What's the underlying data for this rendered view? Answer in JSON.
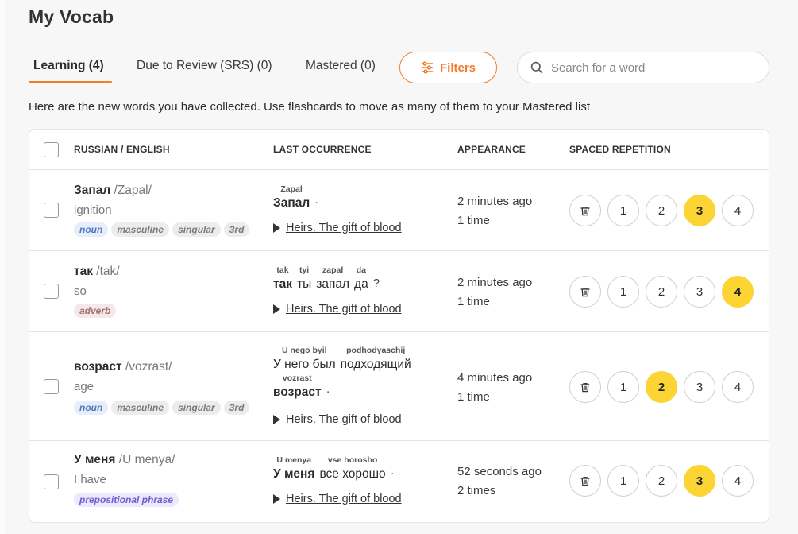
{
  "header": {
    "title": "My Vocab"
  },
  "tabs": [
    {
      "label": "Learning (4)",
      "active": true
    },
    {
      "label": "Due to Review (SRS) (0)",
      "active": false
    },
    {
      "label": "Mastered (0)",
      "active": false
    }
  ],
  "filters": {
    "label": "Filters",
    "icon": "sliders-icon"
  },
  "search": {
    "placeholder": "Search for a word",
    "value": ""
  },
  "intro": "Here are the new words you have collected. Use flashcards to move as many of them to your Mastered list",
  "table": {
    "headers": [
      "RUSSIAN / ENGLISH",
      "LAST OCCURRENCE",
      "APPEARANCE",
      "SPACED REPETITION"
    ],
    "rows": [
      {
        "word": "Запал",
        "translit": "/Zapal/",
        "meaning": "ignition",
        "tags": [
          "noun",
          "masculine",
          "singular",
          "3rd"
        ],
        "occurrence": {
          "lines": [
            {
              "tokens": [
                {
                  "rom": "Zapal",
                  "ru": "Запал",
                  "hl": true
                }
              ],
              "punct": "·"
            }
          ],
          "source": "Heirs. The gift of blood"
        },
        "appearance": {
          "when": "2 minutes ago",
          "count": "1 time"
        },
        "srs": {
          "levels": [
            "1",
            "2",
            "3",
            "4"
          ],
          "selected": "3"
        }
      },
      {
        "word": "так",
        "translit": "/tak/",
        "meaning": "so",
        "tags": [
          "adverb"
        ],
        "occurrence": {
          "lines": [
            {
              "tokens": [
                {
                  "rom": "tak",
                  "ru": "так",
                  "hl": true
                },
                {
                  "rom": "tyi",
                  "ru": "ты",
                  "hl": false
                },
                {
                  "rom": "zapal",
                  "ru": "запал",
                  "hl": false
                },
                {
                  "rom": "da",
                  "ru": "да",
                  "hl": false
                }
              ],
              "punct": "?"
            }
          ],
          "source": "Heirs. The gift of blood"
        },
        "appearance": {
          "when": "2 minutes ago",
          "count": "1 time"
        },
        "srs": {
          "levels": [
            "1",
            "2",
            "3",
            "4"
          ],
          "selected": "4"
        }
      },
      {
        "word": "возраст",
        "translit": "/vozrast/",
        "meaning": "age",
        "tags": [
          "noun",
          "masculine",
          "singular",
          "3rd"
        ],
        "occurrence": {
          "lines": [
            {
              "tokens": [
                {
                  "rom": "U nego byil",
                  "ru": "У него был",
                  "hl": false
                },
                {
                  "rom": "podhodyaschij",
                  "ru": "подходящий",
                  "hl": false
                }
              ],
              "punct": ""
            },
            {
              "tokens": [
                {
                  "rom": "vozrast",
                  "ru": "возраст",
                  "hl": true
                }
              ],
              "punct": "·"
            }
          ],
          "source": "Heirs. The gift of blood"
        },
        "appearance": {
          "when": "4 minutes ago",
          "count": "1 time"
        },
        "srs": {
          "levels": [
            "1",
            "2",
            "3",
            "4"
          ],
          "selected": "2"
        }
      },
      {
        "word": "У меня",
        "translit": "/U menya/",
        "meaning": "I have",
        "tags": [
          "prepositional phrase"
        ],
        "occurrence": {
          "lines": [
            {
              "tokens": [
                {
                  "rom": "U menya",
                  "ru": "У меня",
                  "hl": true
                },
                {
                  "rom": "vse horosho",
                  "ru": "все хорошо",
                  "hl": false
                }
              ],
              "punct": "·"
            }
          ],
          "source": "Heirs. The gift of blood"
        },
        "appearance": {
          "when": "52 seconds ago",
          "count": "2 times"
        },
        "srs": {
          "levels": [
            "1",
            "2",
            "3",
            "4"
          ],
          "selected": "3"
        }
      }
    ]
  },
  "colors": {
    "accent": "#f47b2a",
    "srs_selected": "#fcd535"
  }
}
